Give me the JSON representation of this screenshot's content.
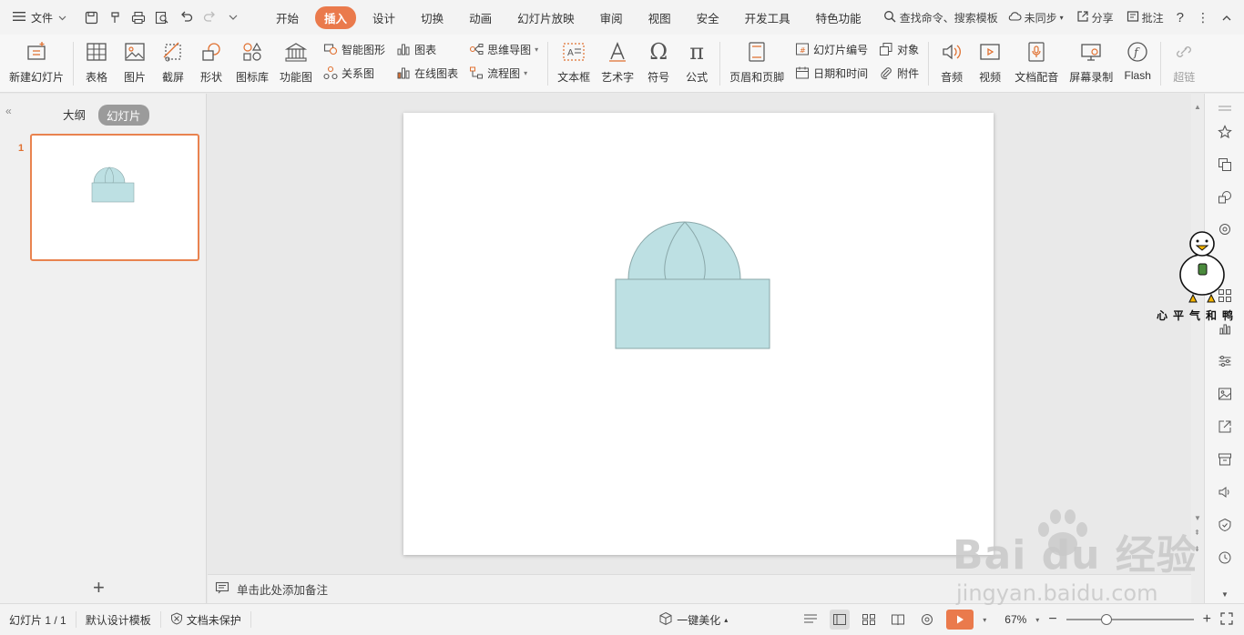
{
  "menubar": {
    "file_label": "文件",
    "tabs": [
      {
        "label": "开始"
      },
      {
        "label": "插入",
        "active": true
      },
      {
        "label": "设计"
      },
      {
        "label": "切换"
      },
      {
        "label": "动画"
      },
      {
        "label": "幻灯片放映"
      },
      {
        "label": "审阅"
      },
      {
        "label": "视图"
      },
      {
        "label": "安全"
      },
      {
        "label": "开发工具"
      },
      {
        "label": "特色功能"
      }
    ],
    "search_label": "查找命令、搜索模板",
    "sync_label": "未同步",
    "share_label": "分享",
    "comment_label": "批注",
    "help_label": "?"
  },
  "ribbon": {
    "new_slide": "新建幻灯片",
    "table": "表格",
    "picture": "图片",
    "screenshot": "截屏",
    "shape": "形状",
    "icon_lib": "图标库",
    "func_chart": "功能图",
    "smart_art": "智能图形",
    "chart": "图表",
    "relation": "关系图",
    "online_chart": "在线图表",
    "mindmap": "思维导图",
    "flowchart": "流程图",
    "textbox": "文本框",
    "wordart": "艺术字",
    "symbol": "符号",
    "formula": "公式",
    "header_footer": "页眉和页脚",
    "slide_number": "幻灯片编号",
    "object": "对象",
    "date_time": "日期和时间",
    "attachment": "附件",
    "audio": "音频",
    "video": "视频",
    "doc_dub": "文档配音",
    "screen_rec": "屏幕录制",
    "flash": "Flash",
    "hyperlink": "超链"
  },
  "leftpanel": {
    "outline_tab": "大纲",
    "slides_tab": "幻灯片",
    "slide_number": "1"
  },
  "notes": {
    "placeholder": "单击此处添加备注"
  },
  "statusbar": {
    "slide_info": "幻灯片 1 / 1",
    "template": "默认设计模板",
    "protection": "文档未保护",
    "beautify": "一键美化",
    "zoom": "67%"
  },
  "colors": {
    "accent": "#ea7a4c",
    "shape_fill": "#bde0e3",
    "shape_stroke": "#8aa7a9"
  },
  "watermark": {
    "main": "Bai du 经验",
    "sub": "jingyan.baidu.com"
  },
  "sticker": {
    "caption": "心平气和鸭"
  }
}
